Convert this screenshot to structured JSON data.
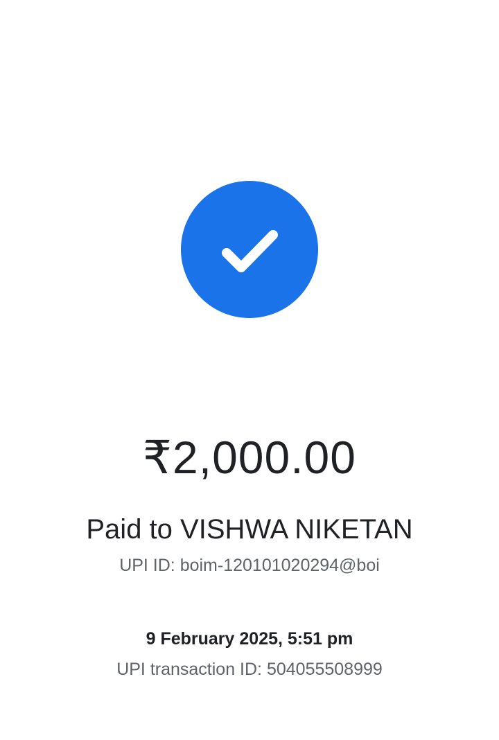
{
  "status": {
    "icon": "checkmark-icon",
    "color": "#1a73e8"
  },
  "payment": {
    "amount": "₹2,000.00",
    "paid_to": "Paid to VISHWA NIKETAN",
    "upi_id": "UPI ID: boim-120101020294@boi",
    "datetime": "9 February 2025, 5:51 pm",
    "transaction_id": "UPI transaction ID: 504055508999"
  }
}
